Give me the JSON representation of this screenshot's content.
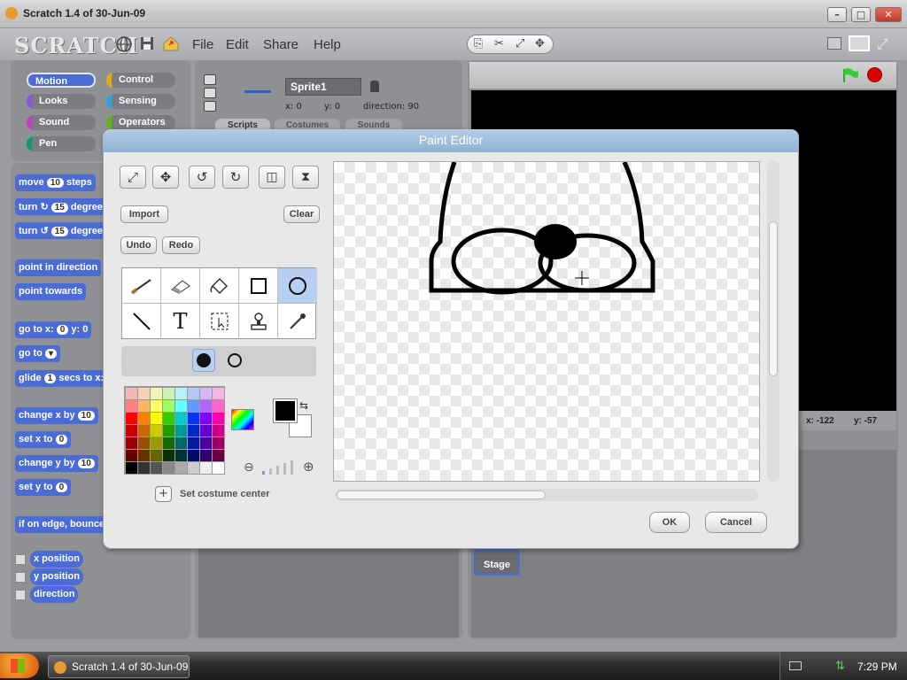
{
  "window": {
    "title": "Scratch 1.4 of 30-Jun-09"
  },
  "menubar": {
    "logo": "SCRATCH",
    "menus": [
      "File",
      "Edit",
      "Share",
      "Help"
    ]
  },
  "categories": {
    "left": [
      {
        "label": "Motion",
        "color": "#4a6cd4"
      },
      {
        "label": "Looks",
        "color": "#8a55d7"
      },
      {
        "label": "Sound",
        "color": "#bb42c3"
      },
      {
        "label": "Pen",
        "color": "#0e9a6c"
      }
    ],
    "right": [
      {
        "label": "Control",
        "color": "#e1a91a"
      },
      {
        "label": "Sensing",
        "color": "#2ca5e2"
      },
      {
        "label": "Operators",
        "color": "#5cb712"
      }
    ]
  },
  "blocks": [
    {
      "label": "move",
      "input": "10",
      "suffix": "steps"
    },
    {
      "label": "turn ↻",
      "input": "15",
      "suffix": "degrees"
    },
    {
      "label": "turn ↺",
      "input": "15",
      "suffix": "degrees"
    },
    {
      "label": "point in direction",
      "input": "",
      "suffix": ""
    },
    {
      "label": "point towards",
      "input": "",
      "suffix": ""
    },
    {
      "label": "go to x:",
      "input": "0",
      "suffix": "y: 0"
    },
    {
      "label": "go to",
      "input": "▾",
      "suffix": ""
    },
    {
      "label": "glide",
      "input": "1",
      "suffix": "secs to x:"
    },
    {
      "label": "change x by",
      "input": "10",
      "suffix": ""
    },
    {
      "label": "set x to",
      "input": "0",
      "suffix": ""
    },
    {
      "label": "change y by",
      "input": "10",
      "suffix": ""
    },
    {
      "label": "set y to",
      "input": "0",
      "suffix": ""
    },
    {
      "label": "if on edge, bounce",
      "input": "",
      "suffix": ""
    }
  ],
  "reporters": [
    "x position",
    "y position",
    "direction"
  ],
  "sprite": {
    "name": "Sprite1",
    "x_label": "x: 0",
    "y_label": "y: 0",
    "direction_label": "direction: 90"
  },
  "sprite_tabs": [
    "Scripts",
    "Costumes",
    "Sounds"
  ],
  "stage": {
    "mouse_x": "x: -122",
    "mouse_y": "y: -57",
    "thumb_label": "Stage"
  },
  "paint_editor": {
    "title": "Paint Editor",
    "buttons": {
      "import": "Import",
      "clear": "Clear",
      "undo": "Undo",
      "redo": "Redo",
      "ok": "OK",
      "cancel": "Cancel"
    },
    "set_center": "Set costume center",
    "selected_tool": "ellipse-tool",
    "foreground": "#000000",
    "background": "#ffffff"
  },
  "taskbar": {
    "task": "Scratch 1.4 of 30-Jun-09",
    "clock": "7:29 PM"
  }
}
